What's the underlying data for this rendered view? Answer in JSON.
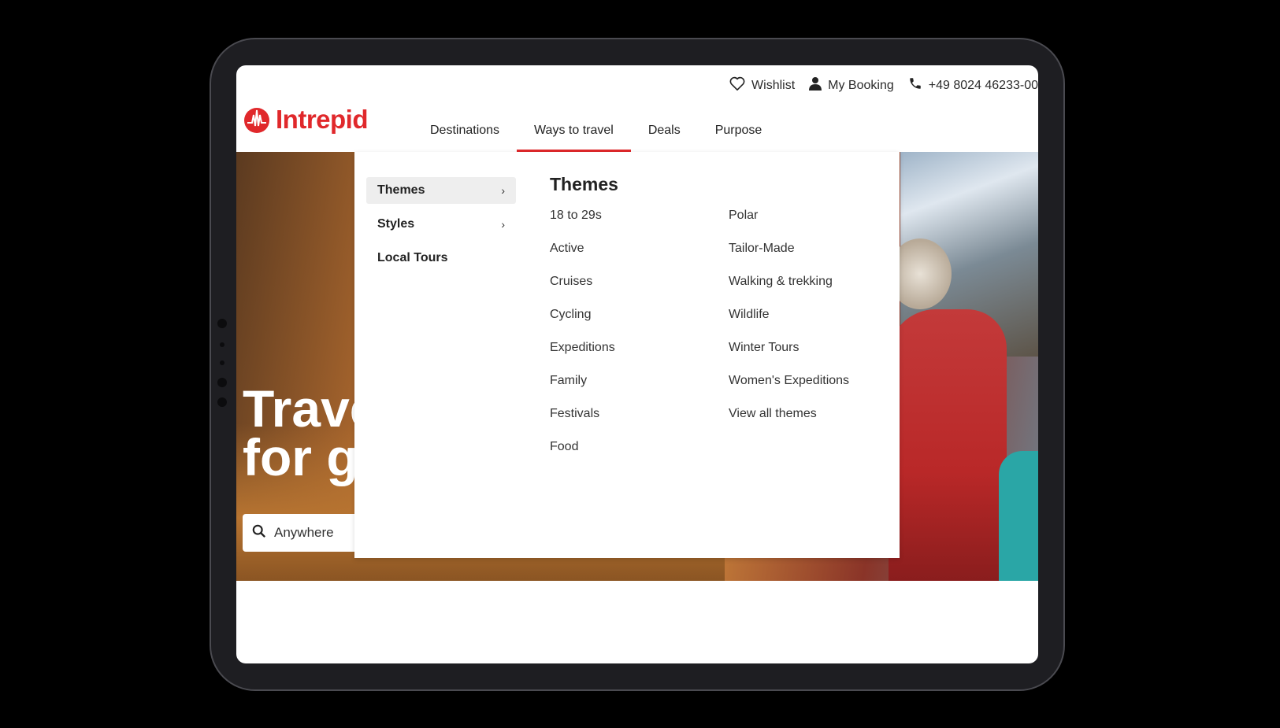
{
  "utility": {
    "wishlist": "Wishlist",
    "booking": "My Booking",
    "phone": "+49 8024 46233-00"
  },
  "brand": {
    "name": "Intrepid",
    "color": "#e0282b"
  },
  "nav": {
    "items": [
      "Destinations",
      "Ways to travel",
      "Deals",
      "Purpose"
    ],
    "active": "Ways to travel"
  },
  "hero": {
    "title": "Trave\nfor g",
    "search_placeholder": "Anywhere"
  },
  "menu": {
    "side": [
      {
        "label": "Themes",
        "chevron": "›"
      },
      {
        "label": "Styles",
        "chevron": "›"
      },
      {
        "label": "Local Tours",
        "chevron": ""
      }
    ],
    "panel_title": "Themes",
    "col1": [
      "18 to 29s",
      "Active",
      "Cruises",
      "Cycling",
      "Expeditions",
      "Family",
      "Festivals",
      "Food"
    ],
    "col2": [
      "Polar",
      "Tailor-Made",
      "Walking & trekking",
      "Wildlife",
      "Winter Tours",
      "Women's Expeditions",
      "View all themes"
    ]
  },
  "icons": {
    "wishlist": "heart-icon",
    "booking": "user-icon",
    "phone": "phone-icon",
    "search": "search-icon",
    "chevron": "chevron-right-icon"
  }
}
